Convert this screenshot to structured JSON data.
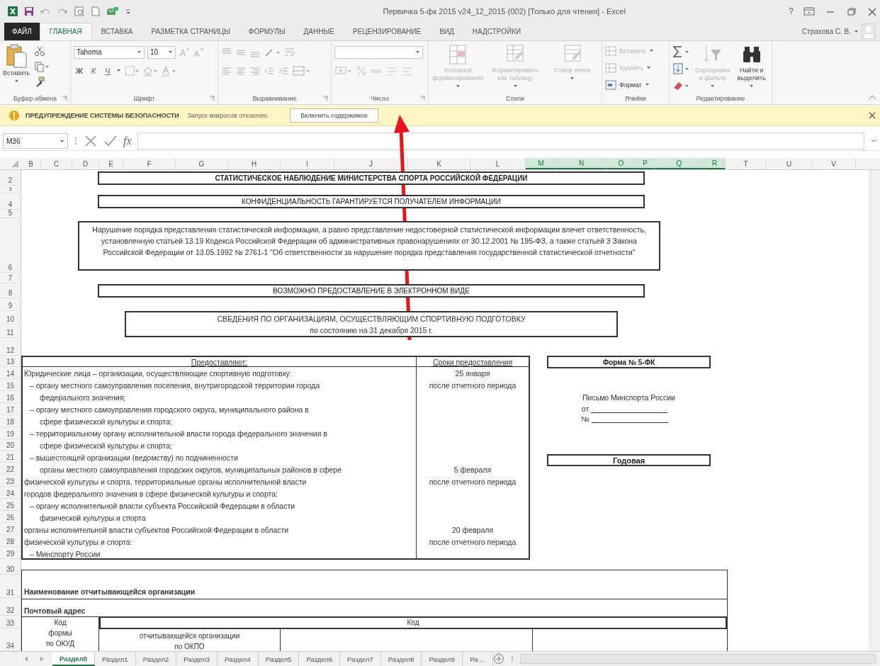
{
  "window": {
    "title": "Первичка 5-фк 2015 v24_12_2015 (002)  [Только для чтения] - Excel",
    "help": "?"
  },
  "ribbon_tabs": [
    {
      "label": "ФАЙЛ",
      "kind": "file",
      "selected": false
    },
    {
      "label": "ГЛАВНАЯ",
      "kind": "tab",
      "selected": true
    },
    {
      "label": "ВСТАВКА",
      "kind": "tab",
      "selected": false
    },
    {
      "label": "РАЗМЕТКА СТРАНИЦЫ",
      "kind": "tab",
      "selected": false
    },
    {
      "label": "ФОРМУЛЫ",
      "kind": "tab",
      "selected": false
    },
    {
      "label": "ДАННЫЕ",
      "kind": "tab",
      "selected": false
    },
    {
      "label": "РЕЦЕНЗИРОВАНИЕ",
      "kind": "tab",
      "selected": false
    },
    {
      "label": "ВИД",
      "kind": "tab",
      "selected": false
    },
    {
      "label": "НАДСТРОЙКИ",
      "kind": "tab",
      "selected": false
    }
  ],
  "user": "Страхова С. В.",
  "ribbon": {
    "groups": [
      {
        "kind": "clipboard",
        "label": "Буфер обмена",
        "paste": "Вставить"
      },
      {
        "kind": "font",
        "label": "Шрифт",
        "font_name": "Tahoma",
        "font_size": "10",
        "style_buttons": [
          "Ж",
          "К",
          "Ч"
        ]
      },
      {
        "kind": "alignment",
        "label": "Выравнивание"
      },
      {
        "kind": "number",
        "label": "Число"
      },
      {
        "kind": "styles",
        "label": "Стили",
        "buttons": [
          {
            "label": "Условное форматирование",
            "disabled": true
          },
          {
            "label": "Форматировать как таблицу",
            "disabled": true
          },
          {
            "label": "Стили ячеек",
            "disabled": true
          }
        ]
      },
      {
        "kind": "cells",
        "label": "Ячейки",
        "buttons": [
          {
            "label": "Вставить",
            "disabled": true
          },
          {
            "label": "Удалить",
            "disabled": true
          },
          {
            "label": "Формат",
            "disabled": false
          }
        ]
      },
      {
        "kind": "editing",
        "label": "Редактирование",
        "buttons": [
          {
            "label": "Сортировка и фильтр",
            "disabled": true
          },
          {
            "label": "Найти и выделить",
            "disabled": false
          }
        ]
      }
    ]
  },
  "security_bar": {
    "title": "ПРЕДУПРЕЖДЕНИЕ СИСТЕМЫ БЕЗОПАСНОСТИ",
    "message": "Запуск макросов отключен.",
    "button": "Включить содержимое"
  },
  "formula_bar": {
    "name_box": "M36",
    "fx": "fx"
  },
  "columns": [
    {
      "label": "B",
      "selected": false
    },
    {
      "label": "C",
      "selected": false
    },
    {
      "label": "D",
      "selected": false
    },
    {
      "label": "E",
      "selected": false
    },
    {
      "label": "F",
      "selected": false
    },
    {
      "label": "G",
      "selected": false
    },
    {
      "label": "H",
      "selected": false
    },
    {
      "label": "I",
      "selected": false
    },
    {
      "label": "J",
      "selected": false
    },
    {
      "label": "K",
      "selected": false
    },
    {
      "label": "L",
      "selected": false
    },
    {
      "label": "M",
      "selected": true
    },
    {
      "label": "N",
      "selected": true
    },
    {
      "label": "O",
      "selected": true
    },
    {
      "label": "P",
      "selected": true
    },
    {
      "label": "Q",
      "selected": true
    },
    {
      "label": "R",
      "selected": true
    },
    {
      "label": "T",
      "selected": false
    },
    {
      "label": "U",
      "selected": false
    },
    {
      "label": "V",
      "selected": false
    }
  ],
  "sheet": {
    "row_numbers": [
      "2",
      "3",
      "4",
      "5",
      "6",
      "7",
      "8",
      "9",
      "10",
      "11",
      "12",
      "13",
      "14",
      "15",
      "16",
      "17",
      "18",
      "19",
      "20",
      "21",
      "22",
      "23",
      "24",
      "25",
      "26",
      "27",
      "28",
      "29",
      "30",
      "31",
      "32",
      "33",
      "34"
    ],
    "title": "СТАТИСТИЧЕСКОЕ НАБЛЮДЕНИЕ МИНИСТЕРСТВА СПОРТА РОССИЙСКОЙ ФЕДЕРАЦИИ",
    "confidentiality": "КОНФИДЕНЦИАЛЬНОСТЬ ГАРАНТИРУЕТСЯ ПОЛУЧАТЕЛЕМ ИНФОРМАЦИИ",
    "legal_notice": "Нарушение порядка представления статистической информации, а равно представление недостоверной статистической информации влечет ответственность, установленную статьей 13.19 Кодекса Российской Федерации об административных правонарушениях от 30.12.2001 № 195-ФЗ, а также статьей 3 Закона Российской Федерации от 13.05.1992 № 2761-1 \"Об ответственности за нарушение порядка представления государственной статистической отчетности\"",
    "electronic": "ВОЗМОЖНО ПРЕДОСТАВЛЕНИЕ В ЭЛЕКТРОННОМ ВИДЕ",
    "report_title": [
      "СВЕДЕНИЯ ПО ОРГАНИЗАЦИЯМ, ОСУЩЕСТВЛЯЮЩИМ СПОРТИВНУЮ ПОДГОТОВКУ",
      "по состоянию на 31 декабря 2015 г."
    ],
    "submitters": {
      "columns": [
        "Предоставляют:",
        "Сроки предоставления"
      ],
      "rows": [
        {
          "kind": "plain",
          "text": "Юридические лица – организации, осуществляющие спортивную подготовку:",
          "deadline": "25 января"
        },
        {
          "kind": "item",
          "text": "– органу местного самоуправления поселения, внутригородской территории города",
          "deadline": "после отчетного периода"
        },
        {
          "kind": "continuation",
          "text": "федерального значения;"
        },
        {
          "kind": "item",
          "text": "– органу местного самоуправления городского округа, муниципального района в"
        },
        {
          "kind": "continuation",
          "text": "сфере физической культуры и спорта;"
        },
        {
          "kind": "item",
          "text": "– территориальному органу исполнительной власти города федерального значения в"
        },
        {
          "kind": "continuation",
          "text": "сфере физической культуры и спорта;"
        },
        {
          "kind": "item",
          "text": "– вышестоящей организации (ведомству) по подчиненности"
        },
        {
          "kind": "continuation",
          "text": "органы местного самоуправления городских округов, муниципальных районов в сфере",
          "deadline": "5 февраля"
        },
        {
          "kind": "plain",
          "text": "физической культуры и спорта, территориальные органы исполнительной власти",
          "deadline": "после отчетного периода"
        },
        {
          "kind": "plain",
          "text": "городов федерального значения в сфере физической культуры и спорта:"
        },
        {
          "kind": "item",
          "text": "– органу исполнительной власти субъекта Российской Федерации в области"
        },
        {
          "kind": "continuation",
          "text": "физической культуры и спорта"
        },
        {
          "kind": "plain",
          "text": "органы исполнительной власти субъектов Российской Федерации в области",
          "deadline": "20 февраля"
        },
        {
          "kind": "plain",
          "text": "физической культуры и спорта:",
          "deadline": "после отчетного периода"
        },
        {
          "kind": "item",
          "text": "– Минспорту России"
        }
      ]
    },
    "form_number": "Форма № 5-ФК",
    "letter": {
      "title": "Письмо Минспорта России",
      "date_label": "от",
      "number_label": "№"
    },
    "period": "Годовая",
    "org_name_label": "Наименование отчитывающейся организации",
    "postal_address_label": "Почтовый адрес",
    "codes": {
      "form_code": [
        "Код",
        "формы",
        "по ОКУД"
      ],
      "code_header": "Код",
      "okpo": [
        "отчитывающейся организации",
        "по ОКПО"
      ]
    }
  },
  "sheet_tabs": [
    {
      "label": "Раздел0",
      "selected": true
    },
    {
      "label": "Раздел1",
      "selected": false
    },
    {
      "label": "Раздел2",
      "selected": false
    },
    {
      "label": "Раздел3",
      "selected": false
    },
    {
      "label": "Раздел4",
      "selected": false
    },
    {
      "label": "Раздел5",
      "selected": false
    },
    {
      "label": "Раздел6",
      "selected": false
    },
    {
      "label": "Раздел7",
      "selected": false
    },
    {
      "label": "Раздел8",
      "selected": false
    },
    {
      "label": "Раздел9",
      "selected": false
    },
    {
      "label": "Ра ...",
      "selected": false
    }
  ]
}
